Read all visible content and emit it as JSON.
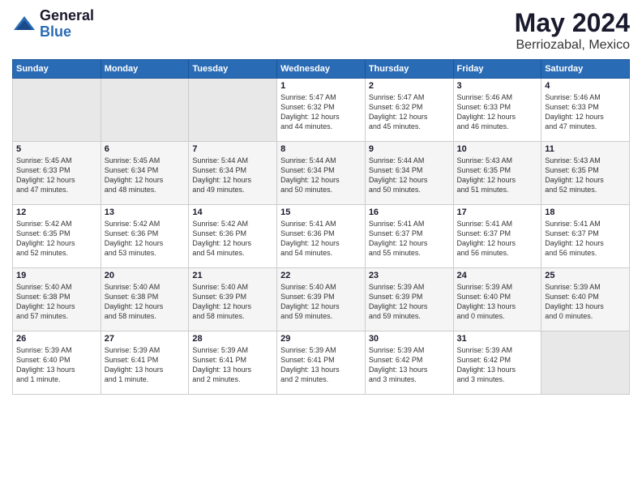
{
  "logo": {
    "general": "General",
    "blue": "Blue"
  },
  "title": "May 2024",
  "location": "Berriozabal, Mexico",
  "days_header": [
    "Sunday",
    "Monday",
    "Tuesday",
    "Wednesday",
    "Thursday",
    "Friday",
    "Saturday"
  ],
  "weeks": [
    [
      {
        "day": "",
        "info": ""
      },
      {
        "day": "",
        "info": ""
      },
      {
        "day": "",
        "info": ""
      },
      {
        "day": "1",
        "info": "Sunrise: 5:47 AM\nSunset: 6:32 PM\nDaylight: 12 hours\nand 44 minutes."
      },
      {
        "day": "2",
        "info": "Sunrise: 5:47 AM\nSunset: 6:32 PM\nDaylight: 12 hours\nand 45 minutes."
      },
      {
        "day": "3",
        "info": "Sunrise: 5:46 AM\nSunset: 6:33 PM\nDaylight: 12 hours\nand 46 minutes."
      },
      {
        "day": "4",
        "info": "Sunrise: 5:46 AM\nSunset: 6:33 PM\nDaylight: 12 hours\nand 47 minutes."
      }
    ],
    [
      {
        "day": "5",
        "info": "Sunrise: 5:45 AM\nSunset: 6:33 PM\nDaylight: 12 hours\nand 47 minutes."
      },
      {
        "day": "6",
        "info": "Sunrise: 5:45 AM\nSunset: 6:34 PM\nDaylight: 12 hours\nand 48 minutes."
      },
      {
        "day": "7",
        "info": "Sunrise: 5:44 AM\nSunset: 6:34 PM\nDaylight: 12 hours\nand 49 minutes."
      },
      {
        "day": "8",
        "info": "Sunrise: 5:44 AM\nSunset: 6:34 PM\nDaylight: 12 hours\nand 50 minutes."
      },
      {
        "day": "9",
        "info": "Sunrise: 5:44 AM\nSunset: 6:34 PM\nDaylight: 12 hours\nand 50 minutes."
      },
      {
        "day": "10",
        "info": "Sunrise: 5:43 AM\nSunset: 6:35 PM\nDaylight: 12 hours\nand 51 minutes."
      },
      {
        "day": "11",
        "info": "Sunrise: 5:43 AM\nSunset: 6:35 PM\nDaylight: 12 hours\nand 52 minutes."
      }
    ],
    [
      {
        "day": "12",
        "info": "Sunrise: 5:42 AM\nSunset: 6:35 PM\nDaylight: 12 hours\nand 52 minutes."
      },
      {
        "day": "13",
        "info": "Sunrise: 5:42 AM\nSunset: 6:36 PM\nDaylight: 12 hours\nand 53 minutes."
      },
      {
        "day": "14",
        "info": "Sunrise: 5:42 AM\nSunset: 6:36 PM\nDaylight: 12 hours\nand 54 minutes."
      },
      {
        "day": "15",
        "info": "Sunrise: 5:41 AM\nSunset: 6:36 PM\nDaylight: 12 hours\nand 54 minutes."
      },
      {
        "day": "16",
        "info": "Sunrise: 5:41 AM\nSunset: 6:37 PM\nDaylight: 12 hours\nand 55 minutes."
      },
      {
        "day": "17",
        "info": "Sunrise: 5:41 AM\nSunset: 6:37 PM\nDaylight: 12 hours\nand 56 minutes."
      },
      {
        "day": "18",
        "info": "Sunrise: 5:41 AM\nSunset: 6:37 PM\nDaylight: 12 hours\nand 56 minutes."
      }
    ],
    [
      {
        "day": "19",
        "info": "Sunrise: 5:40 AM\nSunset: 6:38 PM\nDaylight: 12 hours\nand 57 minutes."
      },
      {
        "day": "20",
        "info": "Sunrise: 5:40 AM\nSunset: 6:38 PM\nDaylight: 12 hours\nand 58 minutes."
      },
      {
        "day": "21",
        "info": "Sunrise: 5:40 AM\nSunset: 6:39 PM\nDaylight: 12 hours\nand 58 minutes."
      },
      {
        "day": "22",
        "info": "Sunrise: 5:40 AM\nSunset: 6:39 PM\nDaylight: 12 hours\nand 59 minutes."
      },
      {
        "day": "23",
        "info": "Sunrise: 5:39 AM\nSunset: 6:39 PM\nDaylight: 12 hours\nand 59 minutes."
      },
      {
        "day": "24",
        "info": "Sunrise: 5:39 AM\nSunset: 6:40 PM\nDaylight: 13 hours\nand 0 minutes."
      },
      {
        "day": "25",
        "info": "Sunrise: 5:39 AM\nSunset: 6:40 PM\nDaylight: 13 hours\nand 0 minutes."
      }
    ],
    [
      {
        "day": "26",
        "info": "Sunrise: 5:39 AM\nSunset: 6:40 PM\nDaylight: 13 hours\nand 1 minute."
      },
      {
        "day": "27",
        "info": "Sunrise: 5:39 AM\nSunset: 6:41 PM\nDaylight: 13 hours\nand 1 minute."
      },
      {
        "day": "28",
        "info": "Sunrise: 5:39 AM\nSunset: 6:41 PM\nDaylight: 13 hours\nand 2 minutes."
      },
      {
        "day": "29",
        "info": "Sunrise: 5:39 AM\nSunset: 6:41 PM\nDaylight: 13 hours\nand 2 minutes."
      },
      {
        "day": "30",
        "info": "Sunrise: 5:39 AM\nSunset: 6:42 PM\nDaylight: 13 hours\nand 3 minutes."
      },
      {
        "day": "31",
        "info": "Sunrise: 5:39 AM\nSunset: 6:42 PM\nDaylight: 13 hours\nand 3 minutes."
      },
      {
        "day": "",
        "info": ""
      }
    ]
  ]
}
